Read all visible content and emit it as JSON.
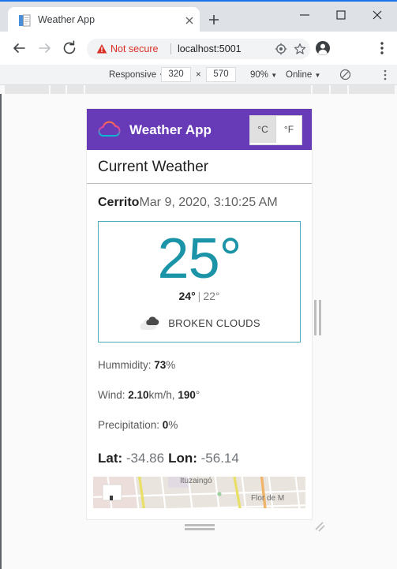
{
  "browser": {
    "tab": {
      "title": "Weather App",
      "favicon_icon": "page-favicon-icon",
      "close_icon": "close-icon"
    },
    "new_tab_icon": "plus-icon",
    "window_controls": {
      "minimize_icon": "minimize-icon",
      "maximize_icon": "maximize-icon",
      "close_icon": "close-icon"
    },
    "nav": {
      "back_icon": "arrow-back-icon",
      "forward_icon": "arrow-forward-icon",
      "reload_icon": "reload-icon"
    },
    "omnibox": {
      "warning_icon": "warning-triangle-icon",
      "security_label": "Not secure",
      "url": "localhost:5001",
      "target_icon": "target-icon",
      "star_icon": "star-icon"
    },
    "profile_icon": "account-avatar-icon",
    "menu_icon": "three-dot-menu-icon"
  },
  "device_toolbar": {
    "device_label": "Responsive",
    "device_caret": "▼",
    "width": "320",
    "times": "×",
    "height": "570",
    "zoom_label": "90%",
    "zoom_caret": "▼",
    "network_label": "Online",
    "network_caret": "▼",
    "throttle_icon": "no-throttling-icon",
    "more_icon": "three-dot-menu-icon"
  },
  "app": {
    "header": {
      "logo_icon": "cloud-outline-logo-icon",
      "title": "Weather App",
      "units": [
        {
          "label": "°C",
          "active": true
        },
        {
          "label": "°F",
          "active": false
        }
      ]
    },
    "section_title": "Current Weather",
    "location": {
      "city": "Cerrito",
      "datetime": "Mar 9, 2020, 3:10:25 AM"
    },
    "temperature_card": {
      "current": "25°",
      "high": "24°",
      "separator": "|",
      "low": "22°",
      "condition_icon": "broken-clouds-icon",
      "condition": "BROKEN CLOUDS"
    },
    "details": [
      {
        "label": "Hummidity: ",
        "value": "73",
        "unit": "%"
      },
      {
        "label": "Wind: ",
        "value": "2.10",
        "unit": "km/h, ",
        "value2": "190",
        "unit2": "°"
      },
      {
        "label": "Precipitation: ",
        "value": "0",
        "unit": "%"
      }
    ],
    "coordinates": {
      "lat_label": "Lat: ",
      "lat_value": "-34.86",
      "lon_label": "Lon: ",
      "lon_value": "-56.14"
    },
    "map": {
      "labels": [
        "Ituzaingó",
        "Flor de M"
      ],
      "marker_icon": "map-marker-icon"
    }
  },
  "handles": {
    "right_icon": "resize-width-handle-icon",
    "bottom_icon": "resize-height-handle-icon",
    "corner_icon": "resize-corner-handle-icon"
  },
  "colors": {
    "brand_purple": "#673ab7",
    "accent_teal": "#1b94a8",
    "card_border": "#4aacb8",
    "warning_red": "#d93025"
  }
}
